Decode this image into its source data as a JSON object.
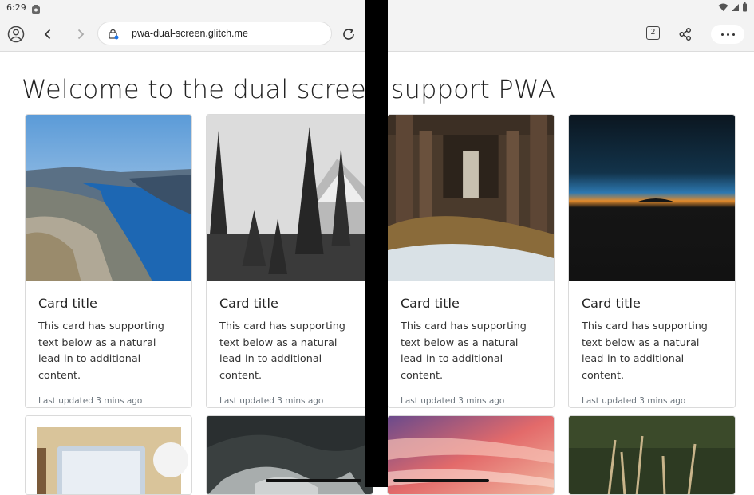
{
  "status": {
    "time": "6:29"
  },
  "browser": {
    "url": "pwa-dual-screen.glitch.me",
    "tab_count": "2"
  },
  "page": {
    "title": "Welcome to the dual screen support PWA"
  },
  "cards": [
    {
      "title": "Card title",
      "text": "This card has supporting text below as a natural lead-in to additional content.",
      "updated": "Last updated 3 mins ago",
      "image": "fjord-mountain-lake"
    },
    {
      "title": "Card title",
      "text": "This card has supporting text below as a natural lead-in to additional content.",
      "updated": "Last updated 3 mins ago",
      "image": "snowy-pine-forest"
    },
    {
      "title": "Card title",
      "text": "This card has supporting text below as a natural lead-in to additional content.",
      "updated": "Last updated 3 mins ago",
      "image": "pier-under-boardwalk"
    },
    {
      "title": "Card title",
      "text": "This card has supporting text below as a natural lead-in to additional content.",
      "updated": "Last updated 3 mins ago",
      "image": "sunset-horizon"
    }
  ],
  "cards_row2": [
    {
      "image": "laptop-desk"
    },
    {
      "image": "misty-forest"
    },
    {
      "image": "pink-clouds"
    },
    {
      "image": "grass-field"
    }
  ],
  "colors": {
    "toolbar": "#f3f3f3",
    "muted_text": "#6c757d",
    "card_border": "#dadada"
  }
}
